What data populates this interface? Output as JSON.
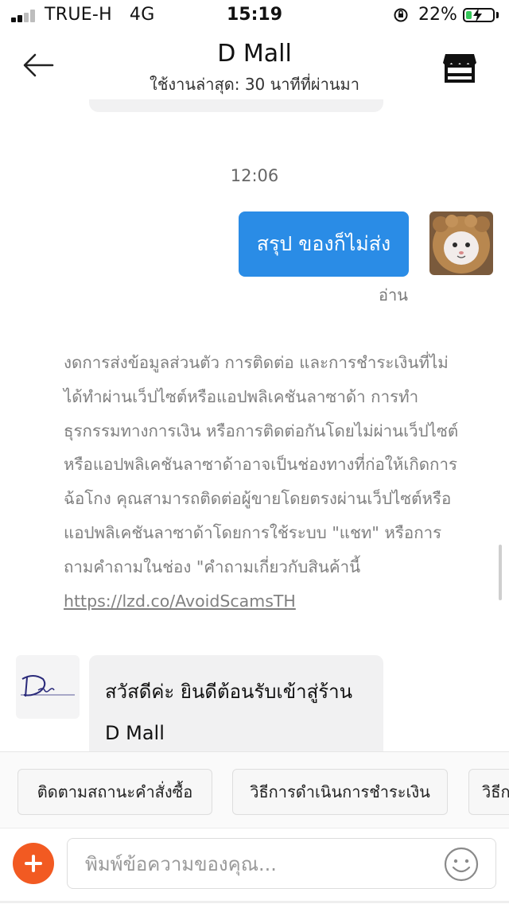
{
  "status_bar": {
    "carrier": "TRUE-H",
    "network": "4G",
    "time": "15:19",
    "battery_percent": "22%",
    "battery_level": 0.22,
    "signal_bars": 2
  },
  "header": {
    "title": "D Mall",
    "subtitle": "ใช้งานล่าสุด: 30 นาทีที่ผ่านมา"
  },
  "chat": {
    "timestamp": "12:06",
    "my_message": "สรุป ของก็ไม่ส่ง",
    "read_status": "อ่าน",
    "notice_text": "งดการส่งข้อมูลส่วนตัว การติดต่อ และการชำระเงินที่ไม่ได้ทำผ่านเว็ปไซต์หรือแอปพลิเคชันลาซาด้า การทำธุรกรรมทางการเงิน หรือการติดต่อกันโดยไม่ผ่านเว็ปไซต์หรือแอปพลิเคชันลาซาด้าอาจเป็นช่องทางที่ก่อให้เกิดการฉ้อโกง คุณสามารถติดต่อผู้ขายโดยตรงผ่านเว็ปไซต์หรือแอปพลิเคชันลาซาด้าโดยการใช้ระบบ \"แชท\" หรือการถามคำถามในช่อง \"คำถามเกี่ยวกับสินค้านี้ ",
    "notice_link": "https://lzd.co/AvoidScamsTH",
    "shop_message": "สวัสดีค่ะ ยินดีต้อนรับเข้าสู่ร้าน D Mall"
  },
  "quick_replies": [
    "ติดตามสถานะคำสั่งซื้อ",
    "วิธีการดำเนินการชำระเงิน",
    "วิธีก"
  ],
  "input": {
    "placeholder": "พิมพ์ข้อความของคุณ..."
  },
  "colors": {
    "accent_blue": "#2a8ce6",
    "plus_orange": "#f25a22",
    "battery_green": "#35c759"
  },
  "icons": {
    "back": "arrow-left-icon",
    "store": "store-icon",
    "plus": "plus-icon",
    "emoji": "smiley-icon"
  }
}
